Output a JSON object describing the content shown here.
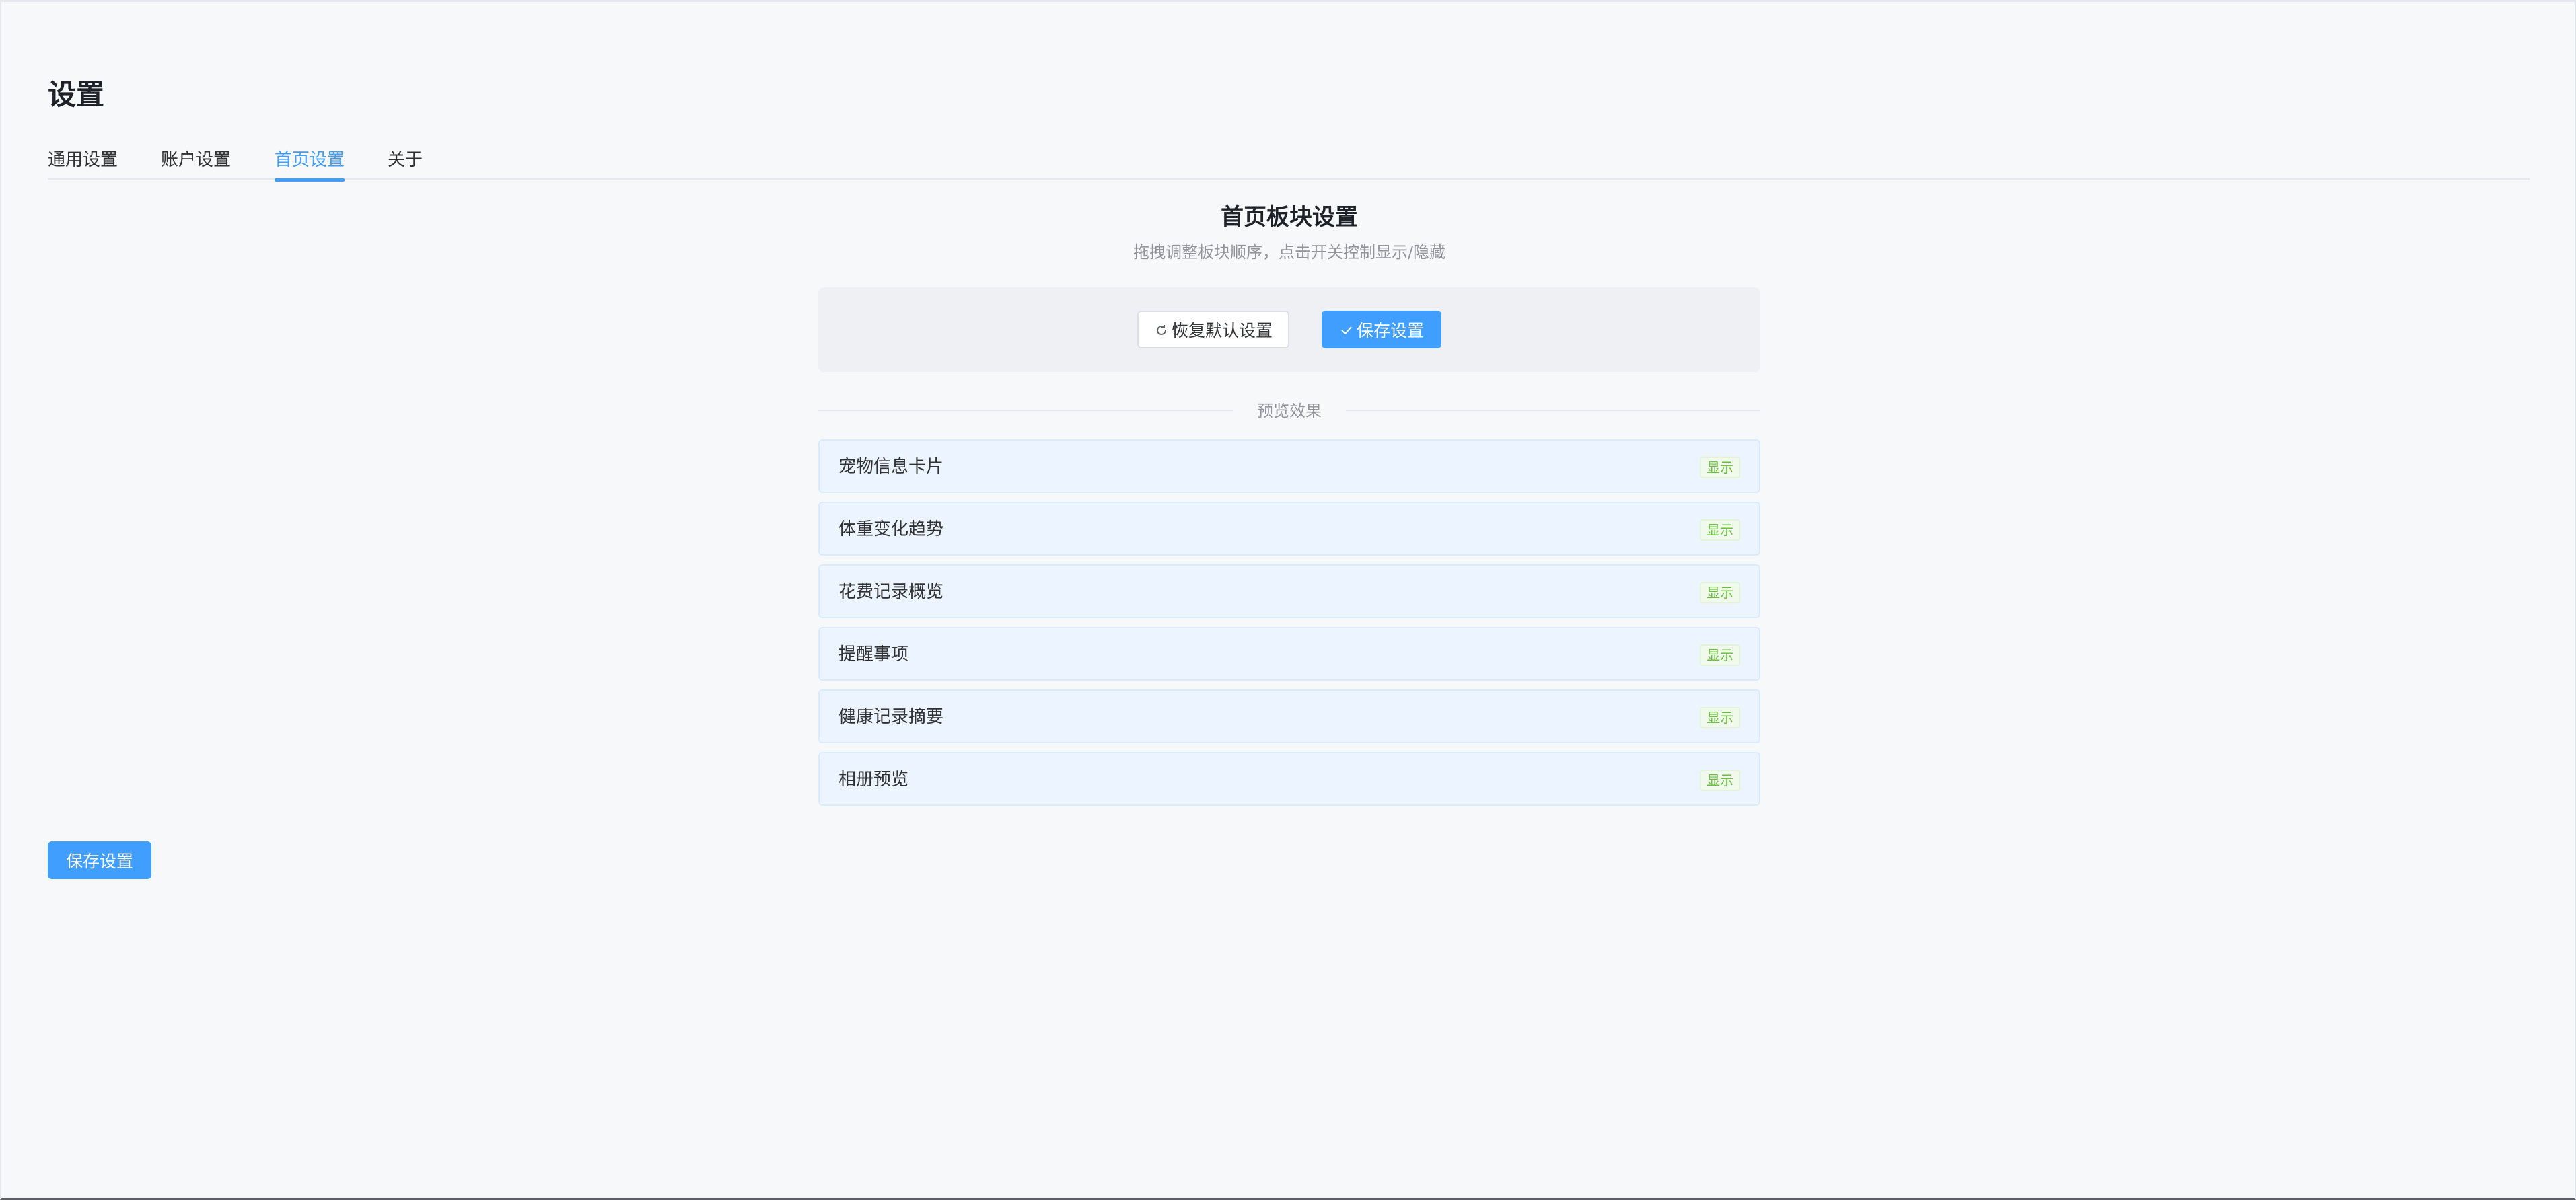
{
  "page": {
    "title": "设置"
  },
  "tabs": [
    {
      "label": "通用设置",
      "active": false
    },
    {
      "label": "账户设置",
      "active": false
    },
    {
      "label": "首页设置",
      "active": true
    },
    {
      "label": "关于",
      "active": false
    }
  ],
  "homepage": {
    "title": "首页板块设置",
    "subtitle": "拖拽调整板块顺序，点击开关控制显示/隐藏",
    "toolbar": {
      "reset_label": "恢复默认设置",
      "reset_icon": "refresh-icon",
      "save_label": "保存设置",
      "save_icon": "check-icon"
    },
    "preview_label": "预览效果",
    "sections": [
      {
        "label": "宠物信息卡片",
        "status": "显示"
      },
      {
        "label": "体重变化趋势",
        "status": "显示"
      },
      {
        "label": "花费记录概览",
        "status": "显示"
      },
      {
        "label": "提醒事项",
        "status": "显示"
      },
      {
        "label": "健康记录摘要",
        "status": "显示"
      },
      {
        "label": "相册预览",
        "status": "显示"
      }
    ]
  },
  "footer": {
    "save_label": "保存设置"
  },
  "colors": {
    "primary": "#409eff",
    "tag_success": "#67c23a",
    "item_bg": "#ecf5ff",
    "page_bg": "#f7f8fa"
  }
}
